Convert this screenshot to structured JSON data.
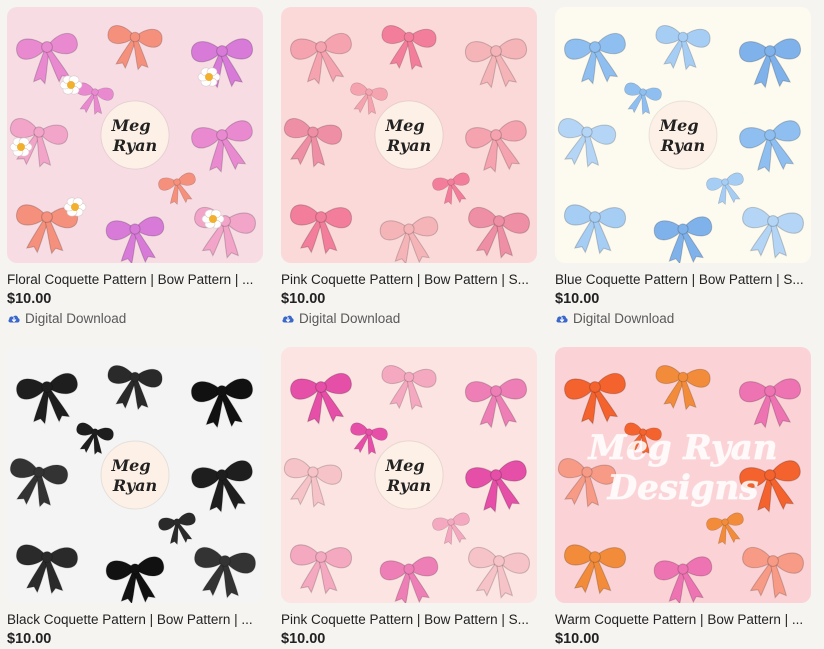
{
  "listings": [
    {
      "title": "Floral Coquette Pattern | Bow Pattern | ...",
      "price": "$10.00",
      "download_label": "Digital Download",
      "thumb": {
        "bg": "#f7dce4",
        "bows": [
          "#e98ad1",
          "#f4907c",
          "#d77ad8",
          "#f2a5c8"
        ],
        "flowers": true,
        "badge": true
      }
    },
    {
      "title": "Pink Coquette Pattern | Bow Pattern | S...",
      "price": "$10.00",
      "download_label": "Digital Download",
      "thumb": {
        "bg": "#fbd9d9",
        "bows": [
          "#f6a3b0",
          "#f37e9c",
          "#f4b4b8",
          "#ef8fa5"
        ],
        "flowers": false,
        "badge": true
      }
    },
    {
      "title": "Blue Coquette Pattern | Bow Pattern | S...",
      "price": "$10.00",
      "download_label": "Digital Download",
      "thumb": {
        "bg": "#fdfbf0",
        "bows": [
          "#8fbff0",
          "#a6cdf4",
          "#7fb2ea",
          "#b4d5f5"
        ],
        "flowers": false,
        "badge": true
      }
    },
    {
      "title": "Black Coquette Pattern | Bow Pattern | ...",
      "price": "$10.00",
      "thumb": {
        "bg": "#f4f4f4",
        "bows": [
          "#1e1e1e",
          "#2a2a2a",
          "#111111",
          "#333333"
        ],
        "flowers": false,
        "badge": true
      }
    },
    {
      "title": "Pink Coquette Pattern | Bow Pattern | S...",
      "price": "$10.00",
      "thumb": {
        "bg": "#fbe4e2",
        "bows": [
          "#e64fa7",
          "#f4a9c0",
          "#ee7fb6",
          "#f6c3c8"
        ],
        "flowers": false,
        "badge": true
      }
    },
    {
      "title": "Warm Coquette Pattern | Bow Pattern | ...",
      "price": "$10.00",
      "thumb": {
        "bg": "#fbd3d6",
        "bows": [
          "#f4622e",
          "#f28c3a",
          "#ee73b3",
          "#f79a86"
        ],
        "flowers": false,
        "badge": false,
        "watermark": [
          "Meg Ryan",
          "Designs"
        ]
      }
    }
  ],
  "badge_text": [
    "Meg",
    "Ryan"
  ],
  "download_icon": "cloud-download-icon",
  "colors": {
    "page_bg": "#f5f4f1",
    "icon_blue": "#3b67c9"
  }
}
